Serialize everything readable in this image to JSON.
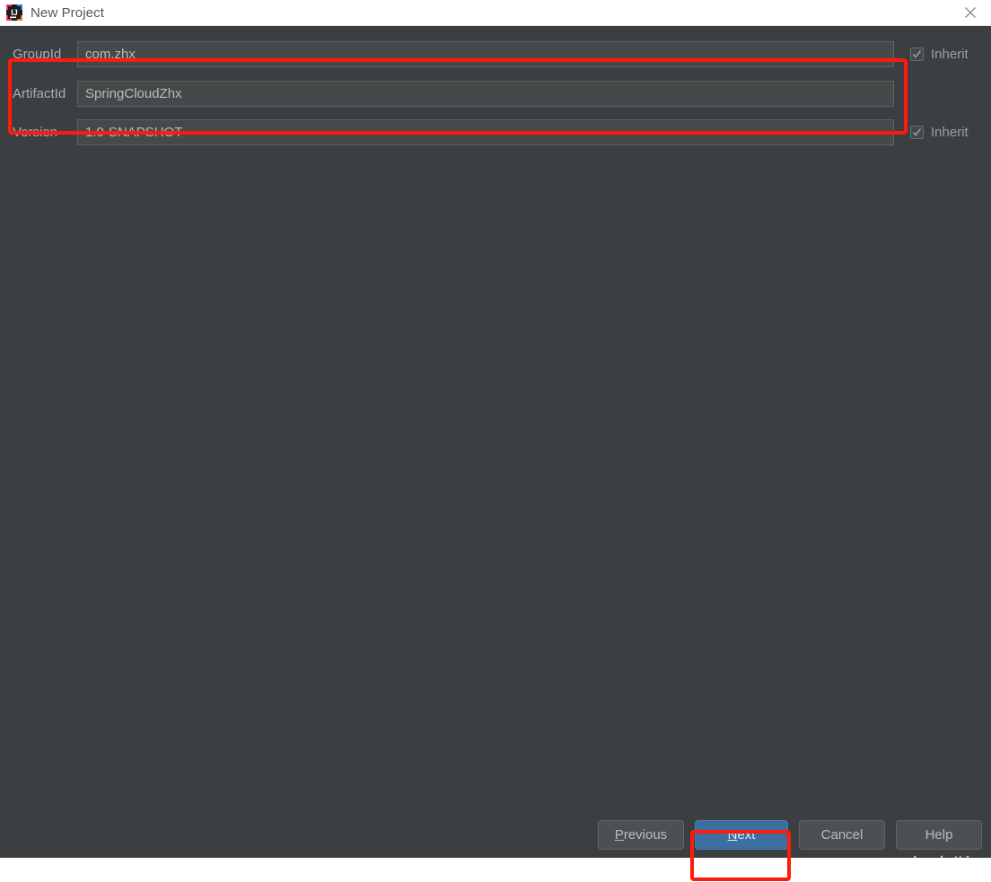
{
  "window": {
    "title": "New Project",
    "app_icon": "intellij-idea-icon",
    "close_icon": "close-icon",
    "background_color": "#3c3f41",
    "titlebar_color": "#ffffff"
  },
  "form": {
    "fields": [
      {
        "label": "GroupId",
        "value": "com.zhx",
        "placeholder": "",
        "name": "groupid",
        "has_inherit": true,
        "inherit_label": "Inherit",
        "inherit_checked": true
      },
      {
        "label": "ArtifactId",
        "value": "SpringCloudZhx",
        "placeholder": "",
        "name": "artifactid",
        "has_inherit": false,
        "inherit_label": "",
        "inherit_checked": false
      },
      {
        "label": "Version",
        "value": "1.0-SNAPSHOT",
        "placeholder": "",
        "name": "version",
        "has_inherit": true,
        "inherit_label": "Inherit",
        "inherit_checked": true
      }
    ]
  },
  "buttons": {
    "previous": {
      "label": "Previous",
      "mnemonic": "P",
      "rest": "revious"
    },
    "next": {
      "label": "Next",
      "mnemonic": "N",
      "rest": "ext"
    },
    "cancel": {
      "label": "Cancel"
    },
    "help": {
      "label": "Help"
    }
  },
  "annotations": {
    "color": "#ff1a0d",
    "regions": [
      {
        "name": "fields-highlight",
        "target": "GroupId and ArtifactId fields"
      },
      {
        "name": "next-highlight",
        "target": "Next button"
      }
    ]
  },
  "watermark": {
    "text": "CSDN @灰太狼yds"
  }
}
